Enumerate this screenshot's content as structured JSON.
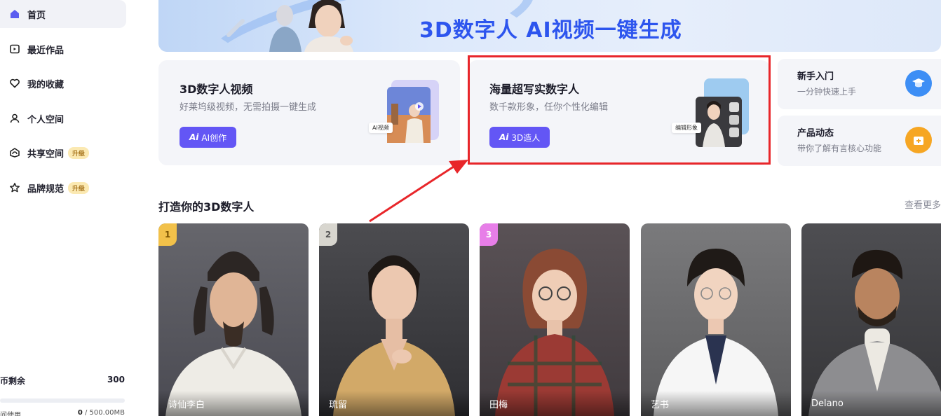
{
  "sidebar": {
    "items": [
      {
        "label": "首页",
        "icon": "home-icon",
        "active": true
      },
      {
        "label": "最近作品",
        "icon": "recent-works-icon"
      },
      {
        "label": "我的收藏",
        "icon": "heart-icon"
      },
      {
        "label": "个人空间",
        "icon": "user-icon"
      },
      {
        "label": "共享空间",
        "icon": "shared-space-icon",
        "badge": "升级"
      },
      {
        "label": "品牌规范",
        "icon": "brand-star-icon",
        "badge": "升级"
      }
    ],
    "credits_label": "币剩余",
    "credits_value": "300",
    "storage_label": "间使用",
    "storage_used": "0",
    "storage_total": " / 500.00MB"
  },
  "banner": {
    "title": "3D数字人 AI视频一键生成"
  },
  "cards": {
    "video": {
      "title": "3D数字人视频",
      "subtitle": "好莱坞级视频，无需拍摄一键生成",
      "button_label": "AI创作",
      "button_mark": "Ai",
      "preview_tag": "AI视频"
    },
    "avatar": {
      "title": "海量超写实数字人",
      "subtitle": "数千款形象，任你个性化编辑",
      "button_label": "3D造人",
      "button_mark": "Ai",
      "preview_tag": "编辑形象"
    }
  },
  "side_cards": [
    {
      "title": "新手入门",
      "subtitle": "一分钟快速上手",
      "icon": "graduation-cap-icon"
    },
    {
      "title": "产品动态",
      "subtitle": "带你了解有言核心功能",
      "icon": "product-news-icon"
    }
  ],
  "section": {
    "title": "打造你的3D数字人",
    "more_label": "查看更多"
  },
  "avatars": [
    {
      "name": "诗仙李白",
      "rank": "1"
    },
    {
      "name": "琉留",
      "rank": "2"
    },
    {
      "name": "田梅",
      "rank": "3"
    },
    {
      "name": "艺书",
      "rank": ""
    },
    {
      "name": "Delano",
      "rank": ""
    }
  ],
  "colors": {
    "accent": "#6356f5",
    "banner_title": "#2d55ee",
    "highlight": "#e8262a",
    "badge_bg": "#fbe9b2",
    "rank_1": "#f2c14a",
    "rank_2": "#d8d6cf",
    "rank_3": "#e77ee8"
  }
}
